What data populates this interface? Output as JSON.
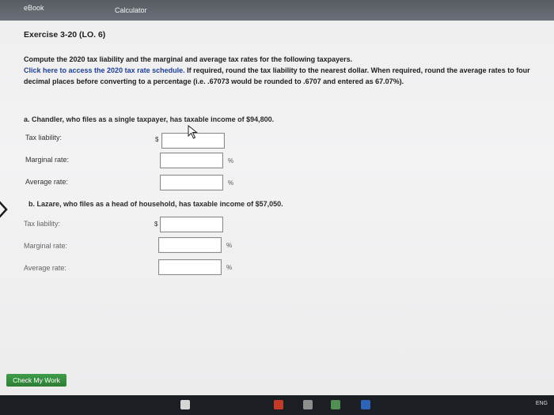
{
  "tabs": {
    "ebook": "eBook",
    "calculator": "Calculator"
  },
  "exercise": {
    "title": "Exercise 3-20 (LO. 6)",
    "question": "Compute the 2020 tax liability and the marginal and average tax rates for the following taxpayers.",
    "instr_link": "Click here to access the 2020 tax rate schedule.",
    "instr_rest": " If required, round the tax liability to the nearest dollar. When required, round the average rates to four decimal places before converting to a percentage (i.e. .67073 would be rounded to .6707 and entered as 67.07%)."
  },
  "part_a": {
    "heading": "a. Chandler, who files as a single taxpayer, has taxable income of $94,800.",
    "tax_liability_label": "Tax liability:",
    "marginal_label": "Marginal rate:",
    "average_label": "Average rate:",
    "dollar": "$",
    "pct": "%",
    "tax_liability_value": "",
    "marginal_value": "",
    "average_value": ""
  },
  "part_b": {
    "heading": "b. Lazare, who files as a head of household, has taxable income of $57,050.",
    "tax_liability_label": "Tax liability:",
    "marginal_label": "Marginal rate:",
    "average_label": "Average rate:",
    "dollar": "$",
    "pct": "%",
    "tax_liability_value": "",
    "marginal_value": "",
    "average_value": ""
  },
  "check_button": "Check My Work",
  "taskbar": {
    "language": "ENG"
  },
  "colors": {
    "link": "#1e3f9c",
    "button": "#2f8a3a"
  }
}
